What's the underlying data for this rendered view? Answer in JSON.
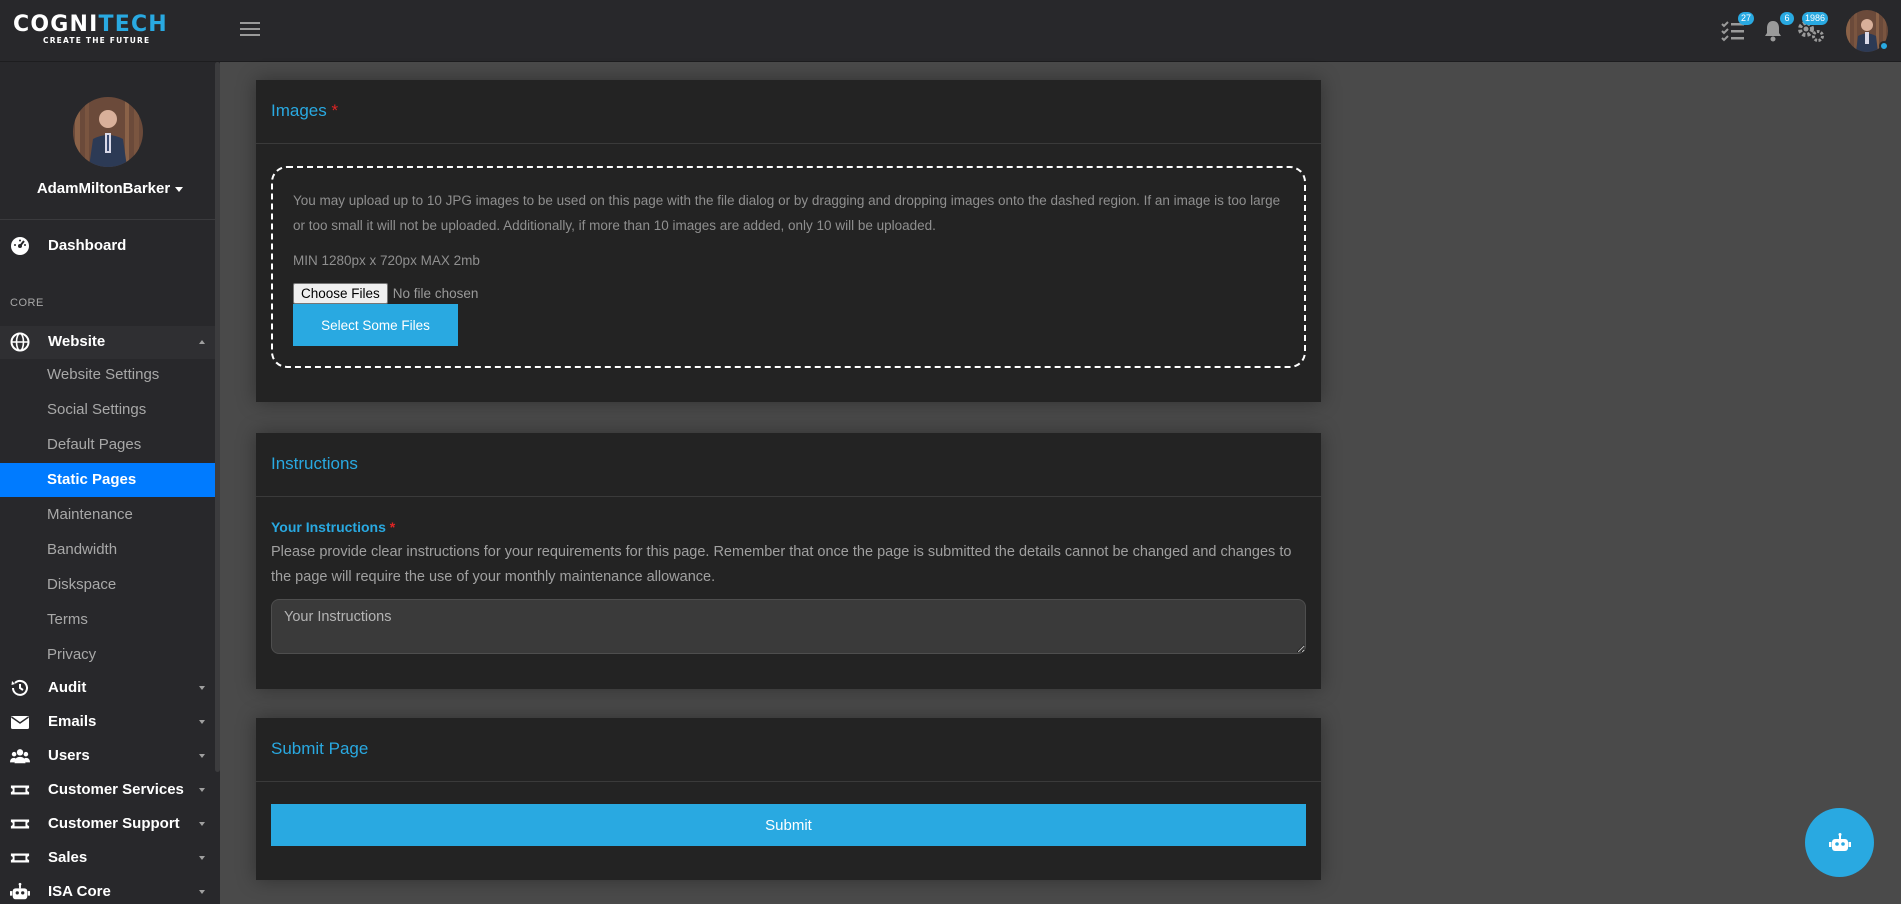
{
  "brand": {
    "name_part1": "COGNI",
    "name_part2": "TECH",
    "tagline": "CREATE THE FUTURE"
  },
  "topbar": {
    "tasks_badge": "27",
    "notifications_badge": "6",
    "settings_badge": "1986"
  },
  "sidebar": {
    "username": "AdamMiltonBarker",
    "dashboard_label": "Dashboard",
    "section_core": "CORE",
    "website_label": "Website",
    "website_items": [
      {
        "label": "Website Settings"
      },
      {
        "label": "Social Settings"
      },
      {
        "label": "Default Pages"
      },
      {
        "label": "Static Pages"
      },
      {
        "label": "Maintenance"
      },
      {
        "label": "Bandwidth"
      },
      {
        "label": "Diskspace"
      },
      {
        "label": "Terms"
      },
      {
        "label": "Privacy"
      }
    ],
    "groups": [
      {
        "label": "Audit",
        "icon": "history-icon"
      },
      {
        "label": "Emails",
        "icon": "envelope-icon"
      },
      {
        "label": "Users",
        "icon": "users-icon"
      },
      {
        "label": "Customer Services",
        "icon": "ticket-icon"
      },
      {
        "label": "Customer Support",
        "icon": "ticket-icon"
      },
      {
        "label": "Sales",
        "icon": "ticket-icon"
      },
      {
        "label": "ISA Core",
        "icon": "robot-icon"
      }
    ]
  },
  "images_card": {
    "title": "Images",
    "required_mark": "*",
    "description": "You may upload up to 10 JPG images to be used on this page with the file dialog or by dragging and dropping images onto the dashed region. If an image is too large or too small it will not be uploaded. Additionally, if more than 10 images are added, only 10 will be uploaded.",
    "constraints": "MIN 1280px x 720px MAX 2mb",
    "choose_files_label": "Choose Files",
    "no_file_label": "No file chosen",
    "select_button": "Select Some Files"
  },
  "instructions_card": {
    "title": "Instructions",
    "field_label": "Your Instructions",
    "required_mark": "*",
    "description": "Please provide clear instructions for your requirements for this page. Remember that once the page is submitted the details cannot be changed and changes to the page will require the use of your monthly maintenance allowance.",
    "placeholder": "Your Instructions"
  },
  "submit_card": {
    "title": "Submit Page",
    "button_label": "Submit"
  },
  "colors": {
    "accent": "#29a9e1",
    "active_nav": "#007bff",
    "required": "#e02424"
  }
}
